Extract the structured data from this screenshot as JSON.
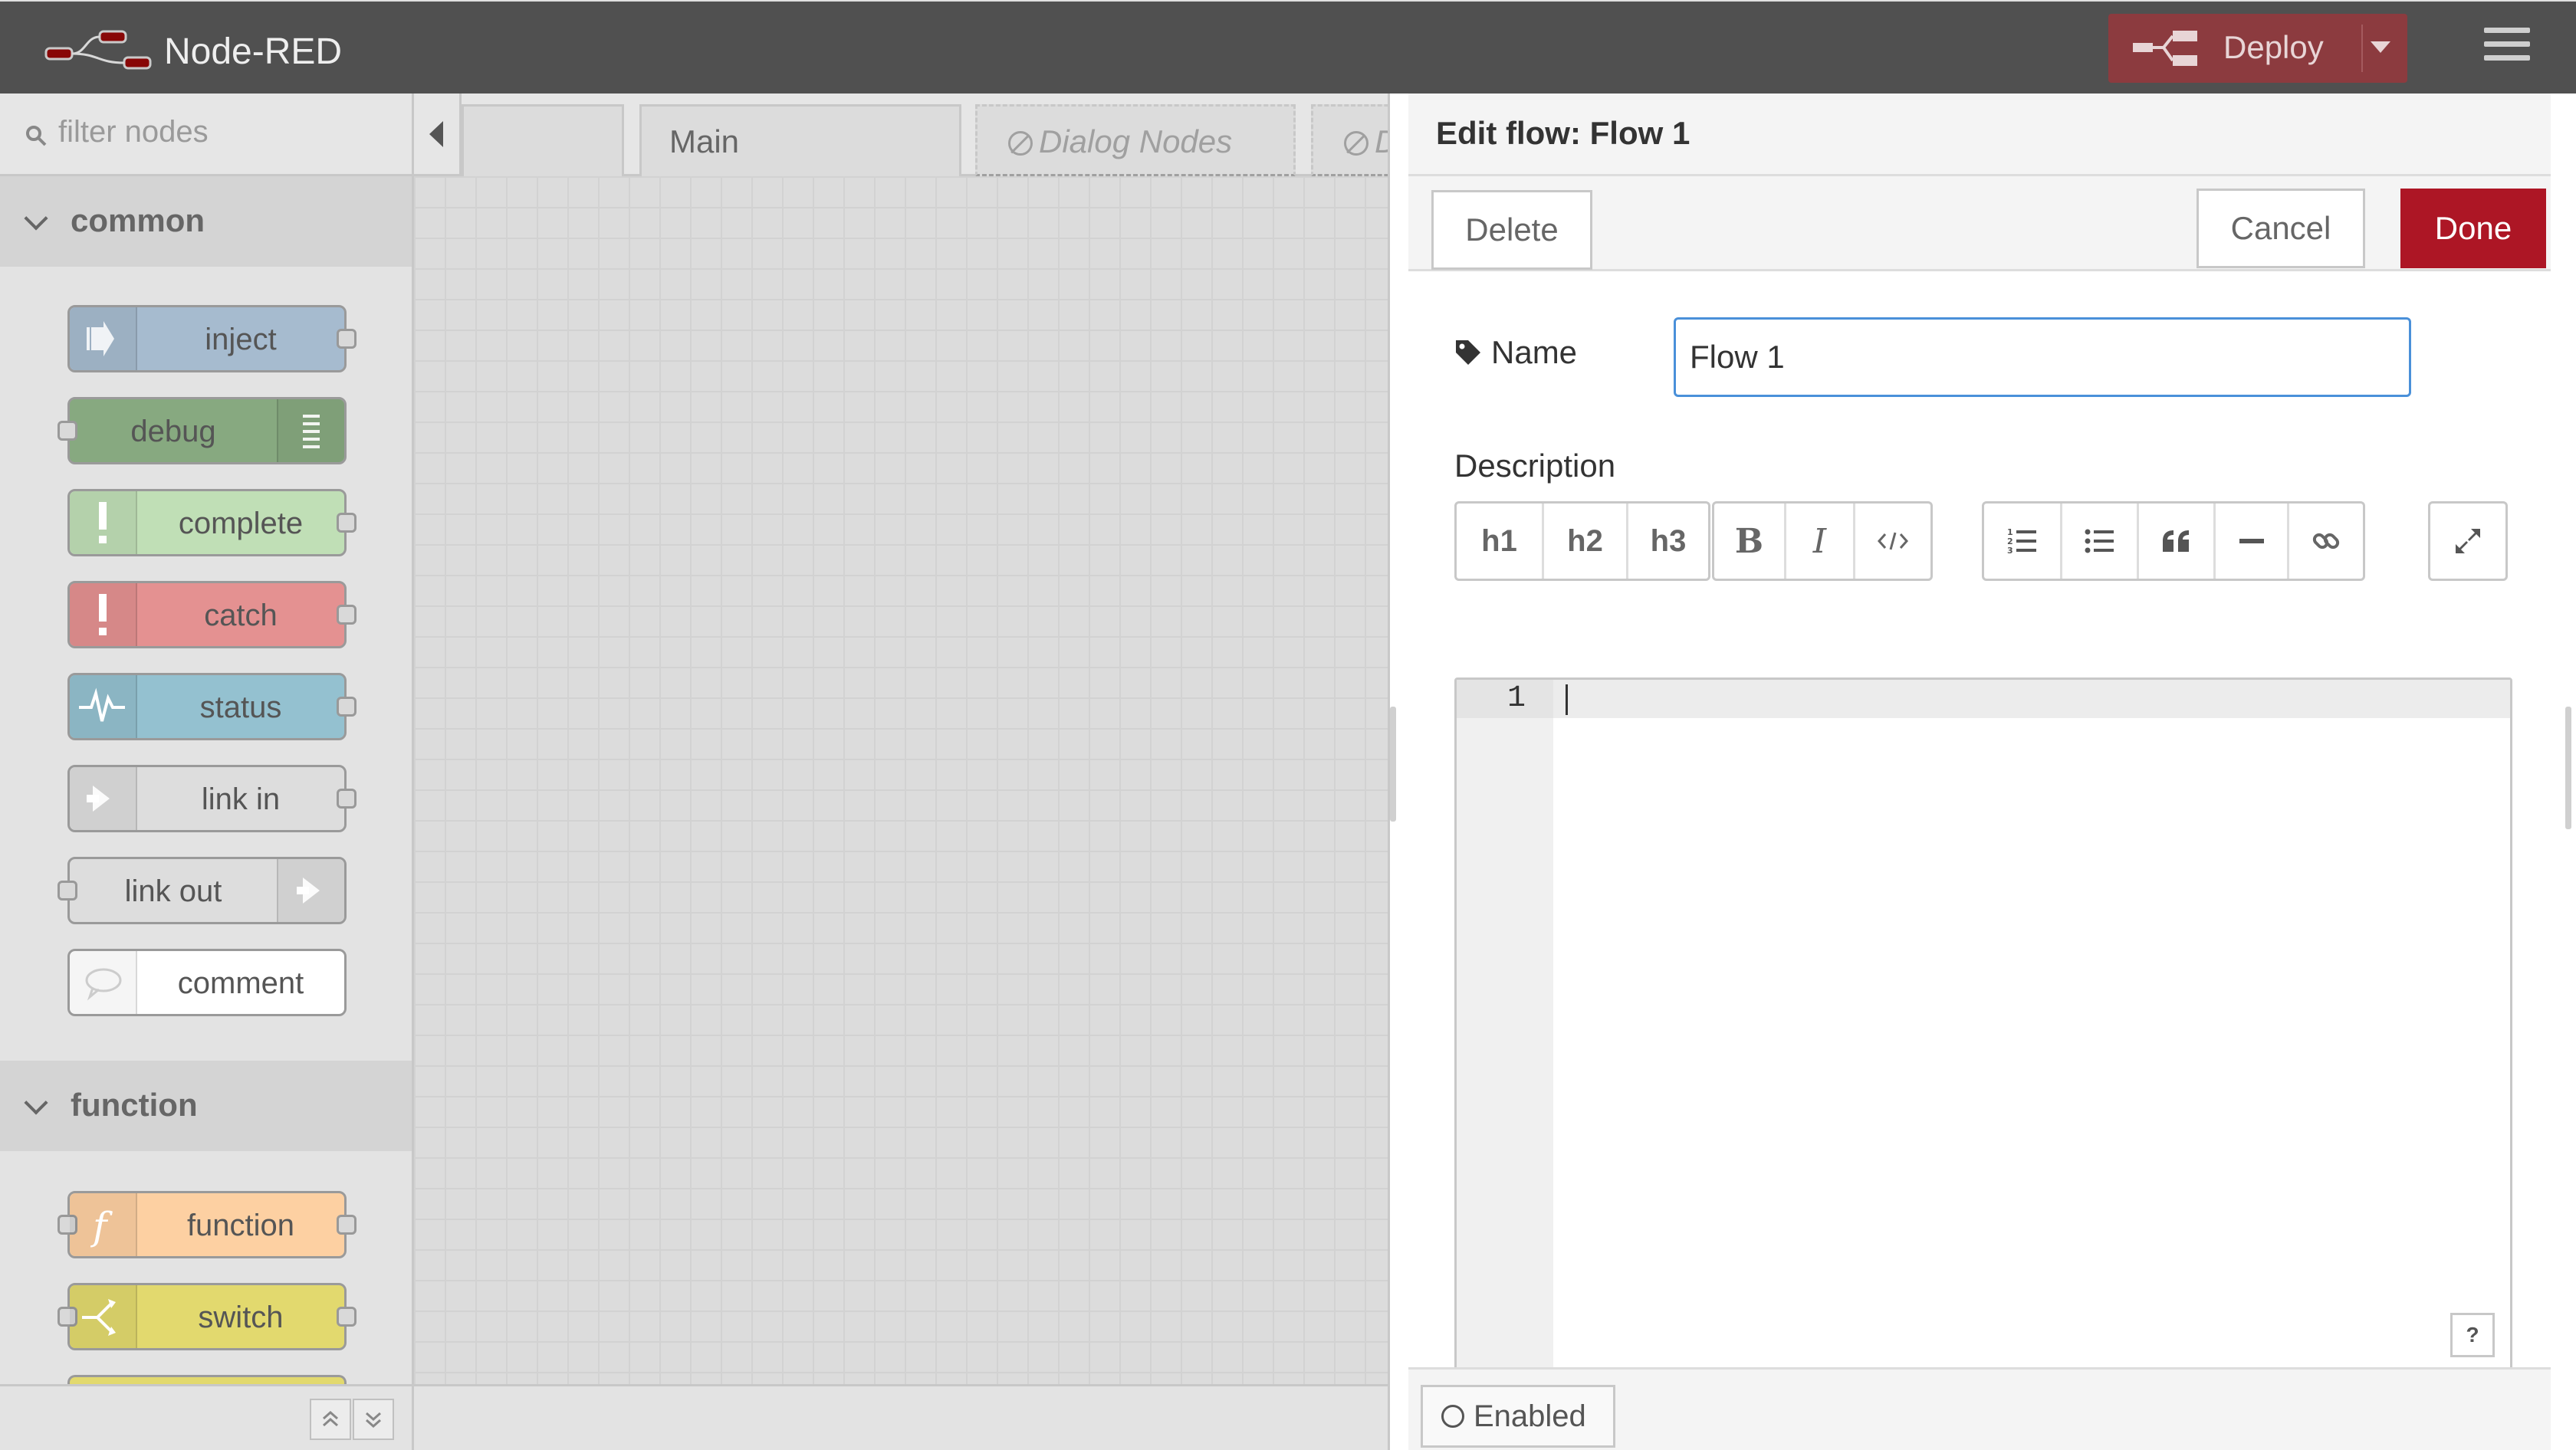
{
  "app": {
    "title": "Node-RED"
  },
  "header": {
    "deploy_label": "Deploy"
  },
  "palette": {
    "filter_placeholder": "filter nodes",
    "categories": [
      {
        "label": "common",
        "nodes": [
          {
            "label": "inject",
            "color": "#a6bbcf"
          },
          {
            "label": "debug",
            "color": "#87a980"
          },
          {
            "label": "complete",
            "color": "#c0deed"
          },
          {
            "label": "catch",
            "color": "#e49191"
          },
          {
            "label": "status",
            "color": "#94c1d0"
          },
          {
            "label": "link in",
            "color": "#dddddd"
          },
          {
            "label": "link out",
            "color": "#dddddd"
          },
          {
            "label": "comment",
            "color": "#ffffff"
          }
        ]
      },
      {
        "label": "function",
        "nodes": [
          {
            "label": "function",
            "color": "#fdd0a2"
          },
          {
            "label": "switch",
            "color": "#e2d96e"
          }
        ]
      }
    ]
  },
  "workspace": {
    "tabs": [
      {
        "label": ""
      },
      {
        "label": "Main"
      },
      {
        "label": "Dialog Nodes",
        "disabled": true
      },
      {
        "label": "D",
        "disabled": true
      }
    ]
  },
  "tray": {
    "title": "Edit flow: Flow 1",
    "delete_label": "Delete",
    "cancel_label": "Cancel",
    "done_label": "Done",
    "name_label": "Name",
    "name_value": "Flow 1",
    "description_label": "Description",
    "toolbar": {
      "headings": [
        "h1",
        "h2",
        "h3"
      ],
      "formatting": [
        "B",
        "I"
      ]
    },
    "editor_line": "1",
    "help_label": "?",
    "enabled_label": "Enabled"
  },
  "colors": {
    "header_bg": "#505050",
    "deploy_bg": "#8c3b3f",
    "done_bg": "#ad1625",
    "focus_border": "#4a90d9"
  }
}
